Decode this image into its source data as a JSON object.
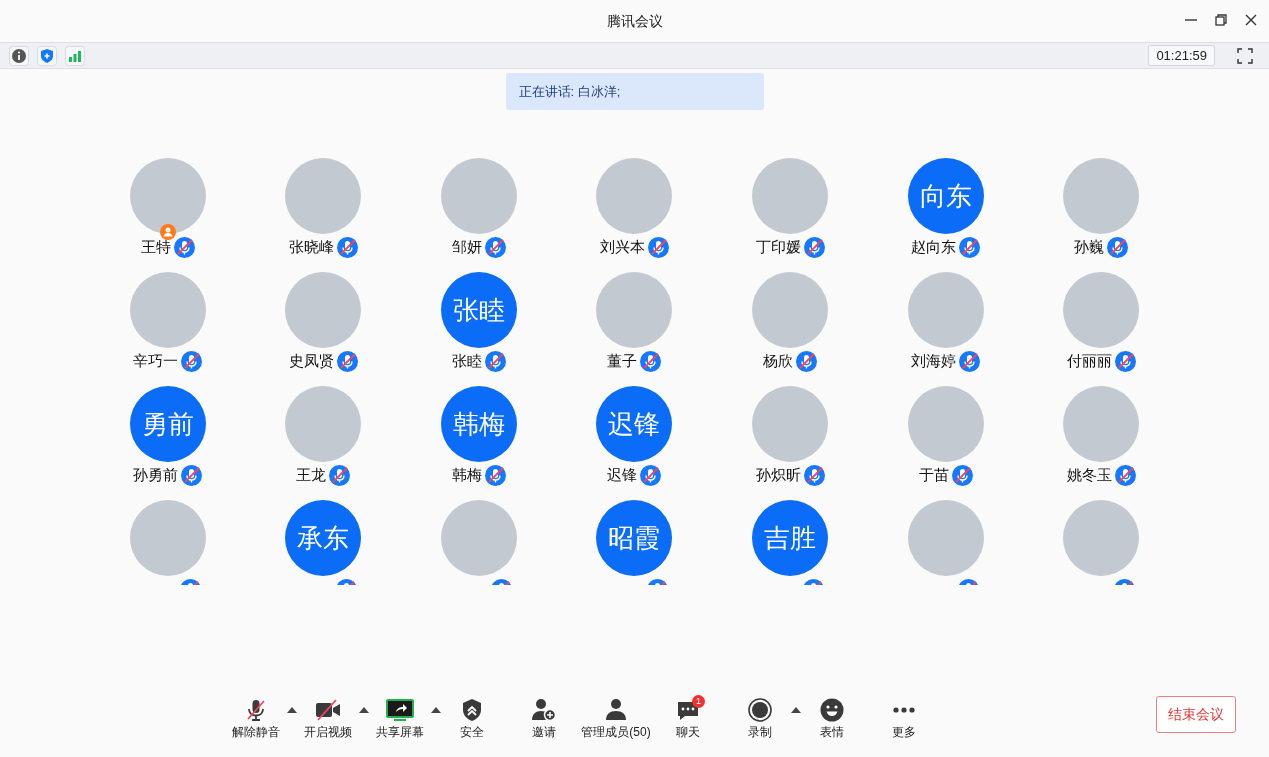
{
  "window": {
    "title": "腾讯会议"
  },
  "info_bar": {
    "timer": "01:21:59"
  },
  "speaking_banner": "正在讲话: 白冰洋;",
  "participants": [
    {
      "kind": "photo",
      "name": "王特",
      "muted": true,
      "host": true
    },
    {
      "kind": "photo",
      "name": "张晓峰",
      "muted": true
    },
    {
      "kind": "photo",
      "name": "邹妍",
      "muted": true
    },
    {
      "kind": "photo",
      "name": "刘兴本",
      "muted": true
    },
    {
      "kind": "photo",
      "name": "丁印媛",
      "muted": true
    },
    {
      "kind": "initials",
      "initials": "向东",
      "name": "赵向东",
      "muted": true
    },
    {
      "kind": "photo",
      "name": "孙巍",
      "muted": true
    },
    {
      "kind": "photo",
      "name": "辛巧一",
      "muted": true
    },
    {
      "kind": "photo",
      "name": "史凤贤",
      "muted": true
    },
    {
      "kind": "initials",
      "initials": "张睦",
      "name": "张睦",
      "muted": true
    },
    {
      "kind": "photo",
      "name": "董子",
      "muted": true
    },
    {
      "kind": "photo",
      "name": "杨欣",
      "muted": true
    },
    {
      "kind": "photo",
      "name": "刘海婷",
      "muted": true
    },
    {
      "kind": "photo",
      "name": "付丽丽",
      "muted": true
    },
    {
      "kind": "initials",
      "initials": "勇前",
      "name": "孙勇前",
      "muted": true
    },
    {
      "kind": "photo",
      "name": "王龙",
      "muted": true
    },
    {
      "kind": "initials",
      "initials": "韩梅",
      "name": "韩梅",
      "muted": true
    },
    {
      "kind": "initials",
      "initials": "迟锋",
      "name": "迟锋",
      "muted": true
    },
    {
      "kind": "photo",
      "name": "孙炽昕",
      "muted": true
    },
    {
      "kind": "photo",
      "name": "于苗",
      "muted": true
    },
    {
      "kind": "photo",
      "name": "姚冬玉",
      "muted": true
    },
    {
      "kind": "photo",
      "muted": true
    },
    {
      "kind": "initials",
      "initials": "承东",
      "muted": true
    },
    {
      "kind": "photo",
      "muted": true
    },
    {
      "kind": "initials",
      "initials": "昭霞",
      "muted": true
    },
    {
      "kind": "initials",
      "initials": "吉胜",
      "muted": true
    },
    {
      "kind": "photo",
      "muted": true
    },
    {
      "kind": "photo",
      "muted": true
    }
  ],
  "toolbar": [
    {
      "kind": "mic",
      "label": "解除静音",
      "off": true,
      "has_menu": true
    },
    {
      "kind": "video",
      "label": "开启视频",
      "off": true,
      "has_menu": true
    },
    {
      "kind": "share",
      "label": "共享屏幕",
      "has_menu": true
    },
    {
      "kind": "security",
      "label": "安全",
      "has_menu": false
    },
    {
      "kind": "invite",
      "label": "邀请",
      "has_menu": false
    },
    {
      "kind": "members",
      "label": "管理成员(50)",
      "has_menu": false
    },
    {
      "kind": "chat",
      "label": "聊天",
      "badge": "1",
      "has_menu": false
    },
    {
      "kind": "record",
      "label": "录制",
      "has_menu": true
    },
    {
      "kind": "emoji",
      "label": "表情",
      "has_menu": false
    },
    {
      "kind": "more",
      "label": "更多",
      "has_menu": false
    }
  ],
  "end_button": "结束会议"
}
